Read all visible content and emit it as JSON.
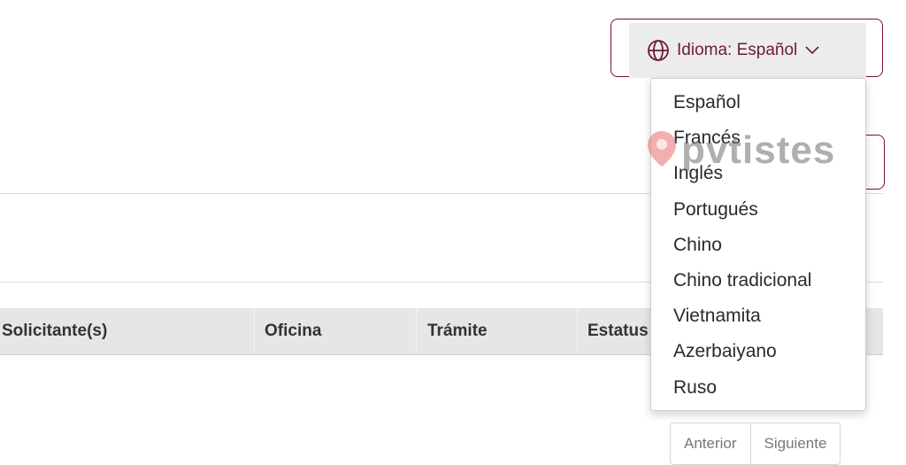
{
  "language": {
    "button_label": "Idioma: Español",
    "options": [
      "Español",
      "Francés",
      "Inglés",
      "Portugués",
      "Chino",
      "Chino tradicional",
      "Vietnamita",
      "Azerbaiyano",
      "Ruso"
    ]
  },
  "table": {
    "headers": [
      "Solicitante(s)",
      "Oficina",
      "Trámite",
      "Estatus"
    ]
  },
  "pagination": {
    "prev": "Anterior",
    "next": "Siguiente"
  },
  "watermark": {
    "text": "pvtistes"
  },
  "colors": {
    "accent": "#7a1330",
    "header_bg": "#e6e6e6"
  }
}
